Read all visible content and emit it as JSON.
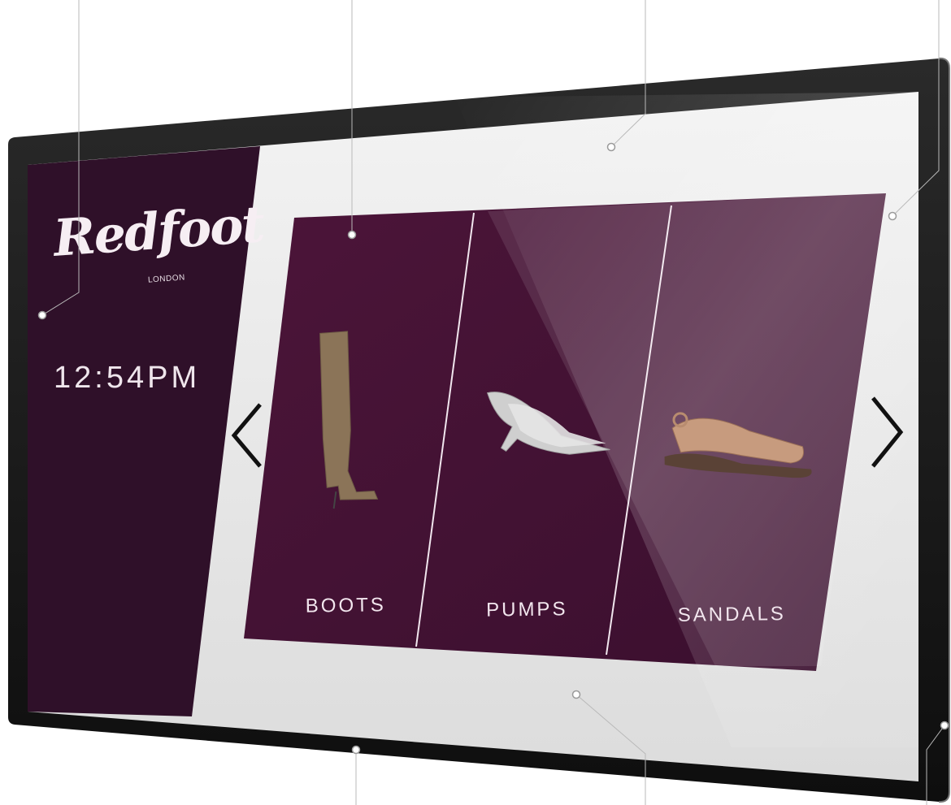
{
  "brand": {
    "name": "Redfoot",
    "subtitle": "LONDON"
  },
  "clock": {
    "time": "12:54PM"
  },
  "categories": [
    {
      "label": "BOOTS",
      "icon": "boot-icon"
    },
    {
      "label": "PUMPS",
      "icon": "pump-shoe-icon"
    },
    {
      "label": "SANDALS",
      "icon": "sandal-icon"
    }
  ],
  "navigation": {
    "prev": "chevron-left-icon",
    "next": "chevron-right-icon"
  },
  "colors": {
    "brand_plum": "#4a1638",
    "sidebar_plum": "#2f1029",
    "bezel": "#1b1b1b",
    "panel_light": "#ececec"
  }
}
